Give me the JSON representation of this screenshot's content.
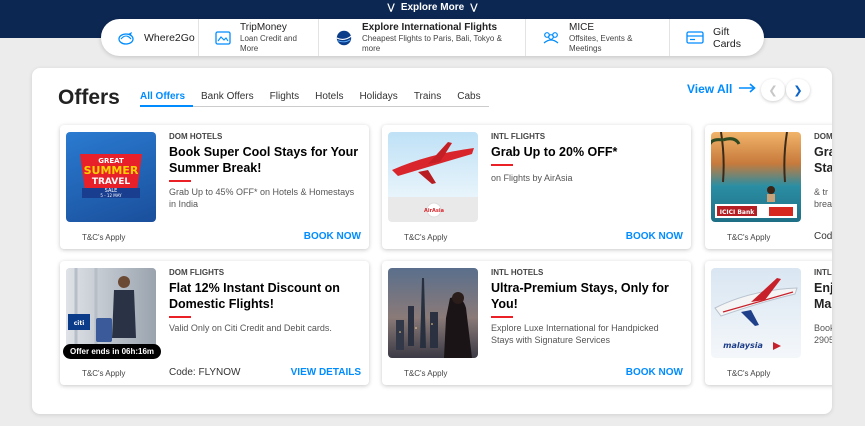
{
  "topbar": {
    "explore_label": "Explore More"
  },
  "nav": [
    {
      "title": "Where2Go",
      "subtitle": "",
      "icon": "globe-plane-icon"
    },
    {
      "title": "TripMoney",
      "subtitle": "Loan Credit and More",
      "icon": "tripmoney-icon"
    },
    {
      "title": "Explore International Flights",
      "subtitle": "Cheapest Flights to Paris, Bali, Tokyo & more",
      "icon": "globe-icon"
    },
    {
      "title": "MICE",
      "subtitle": "Offsites, Events & Meetings",
      "icon": "group-icon"
    },
    {
      "title": "Gift Cards",
      "subtitle": "",
      "icon": "gift-card-icon"
    }
  ],
  "offers": {
    "title": "Offers",
    "tabs": [
      "All Offers",
      "Bank Offers",
      "Flights",
      "Hotels",
      "Holidays",
      "Trains",
      "Cabs"
    ],
    "active_tab": "All Offers",
    "view_all": "View All",
    "cards": [
      {
        "category": "DOM HOTELS",
        "title": "Book Super Cool Stays for Your Summer Break!",
        "desc": "Grab Up to 45% OFF* on Hotels & Homestays in India",
        "tc": "T&C's Apply",
        "cta": "BOOK NOW",
        "badge": {
          "l1": "GREAT",
          "l2": "SUMMER",
          "l3": "TRAVEL",
          "l4": "SALE",
          "dates": "5 - 12 MAY"
        }
      },
      {
        "category": "INTL FLIGHTS",
        "title": "Grab Up to 20% OFF*",
        "desc": "on Flights by AirAsia",
        "tc": "T&C's Apply",
        "cta": "BOOK NOW",
        "logo": "AirAsia"
      },
      {
        "category": "DOM FLIGHTS",
        "title": "Flat 12% Instant Discount on Domestic Flights!",
        "desc": "Valid Only on Citi Credit and Debit cards.",
        "tc": "T&C's Apply",
        "cta": "VIEW DETAILS",
        "code": "Code: FLYNOW",
        "timer": "Offer ends in 06h:16m"
      },
      {
        "category": "INTL HOTELS",
        "title": "Ultra-Premium Stays, Only for You!",
        "desc": "Explore Luxe International for Handpicked Stays with Signature Services",
        "tc": "T&C's Apply",
        "cta": "BOOK NOW"
      }
    ],
    "edge_cards": [
      {
        "category": "DOM",
        "title_l1": "Gra",
        "title_l2": "Sta",
        "desc_l1": "& tr",
        "desc_l2": "brea",
        "tc": "T&C's Apply",
        "code": "Cod",
        "logo": "ICICI Bank"
      },
      {
        "category": "INTL",
        "title_l1": "Enj",
        "title_l2": "Ma",
        "desc_l1": "Book",
        "desc_l2": "2905",
        "tc": "T&C's Apply",
        "code": "",
        "logo": "malaysia"
      }
    ]
  }
}
